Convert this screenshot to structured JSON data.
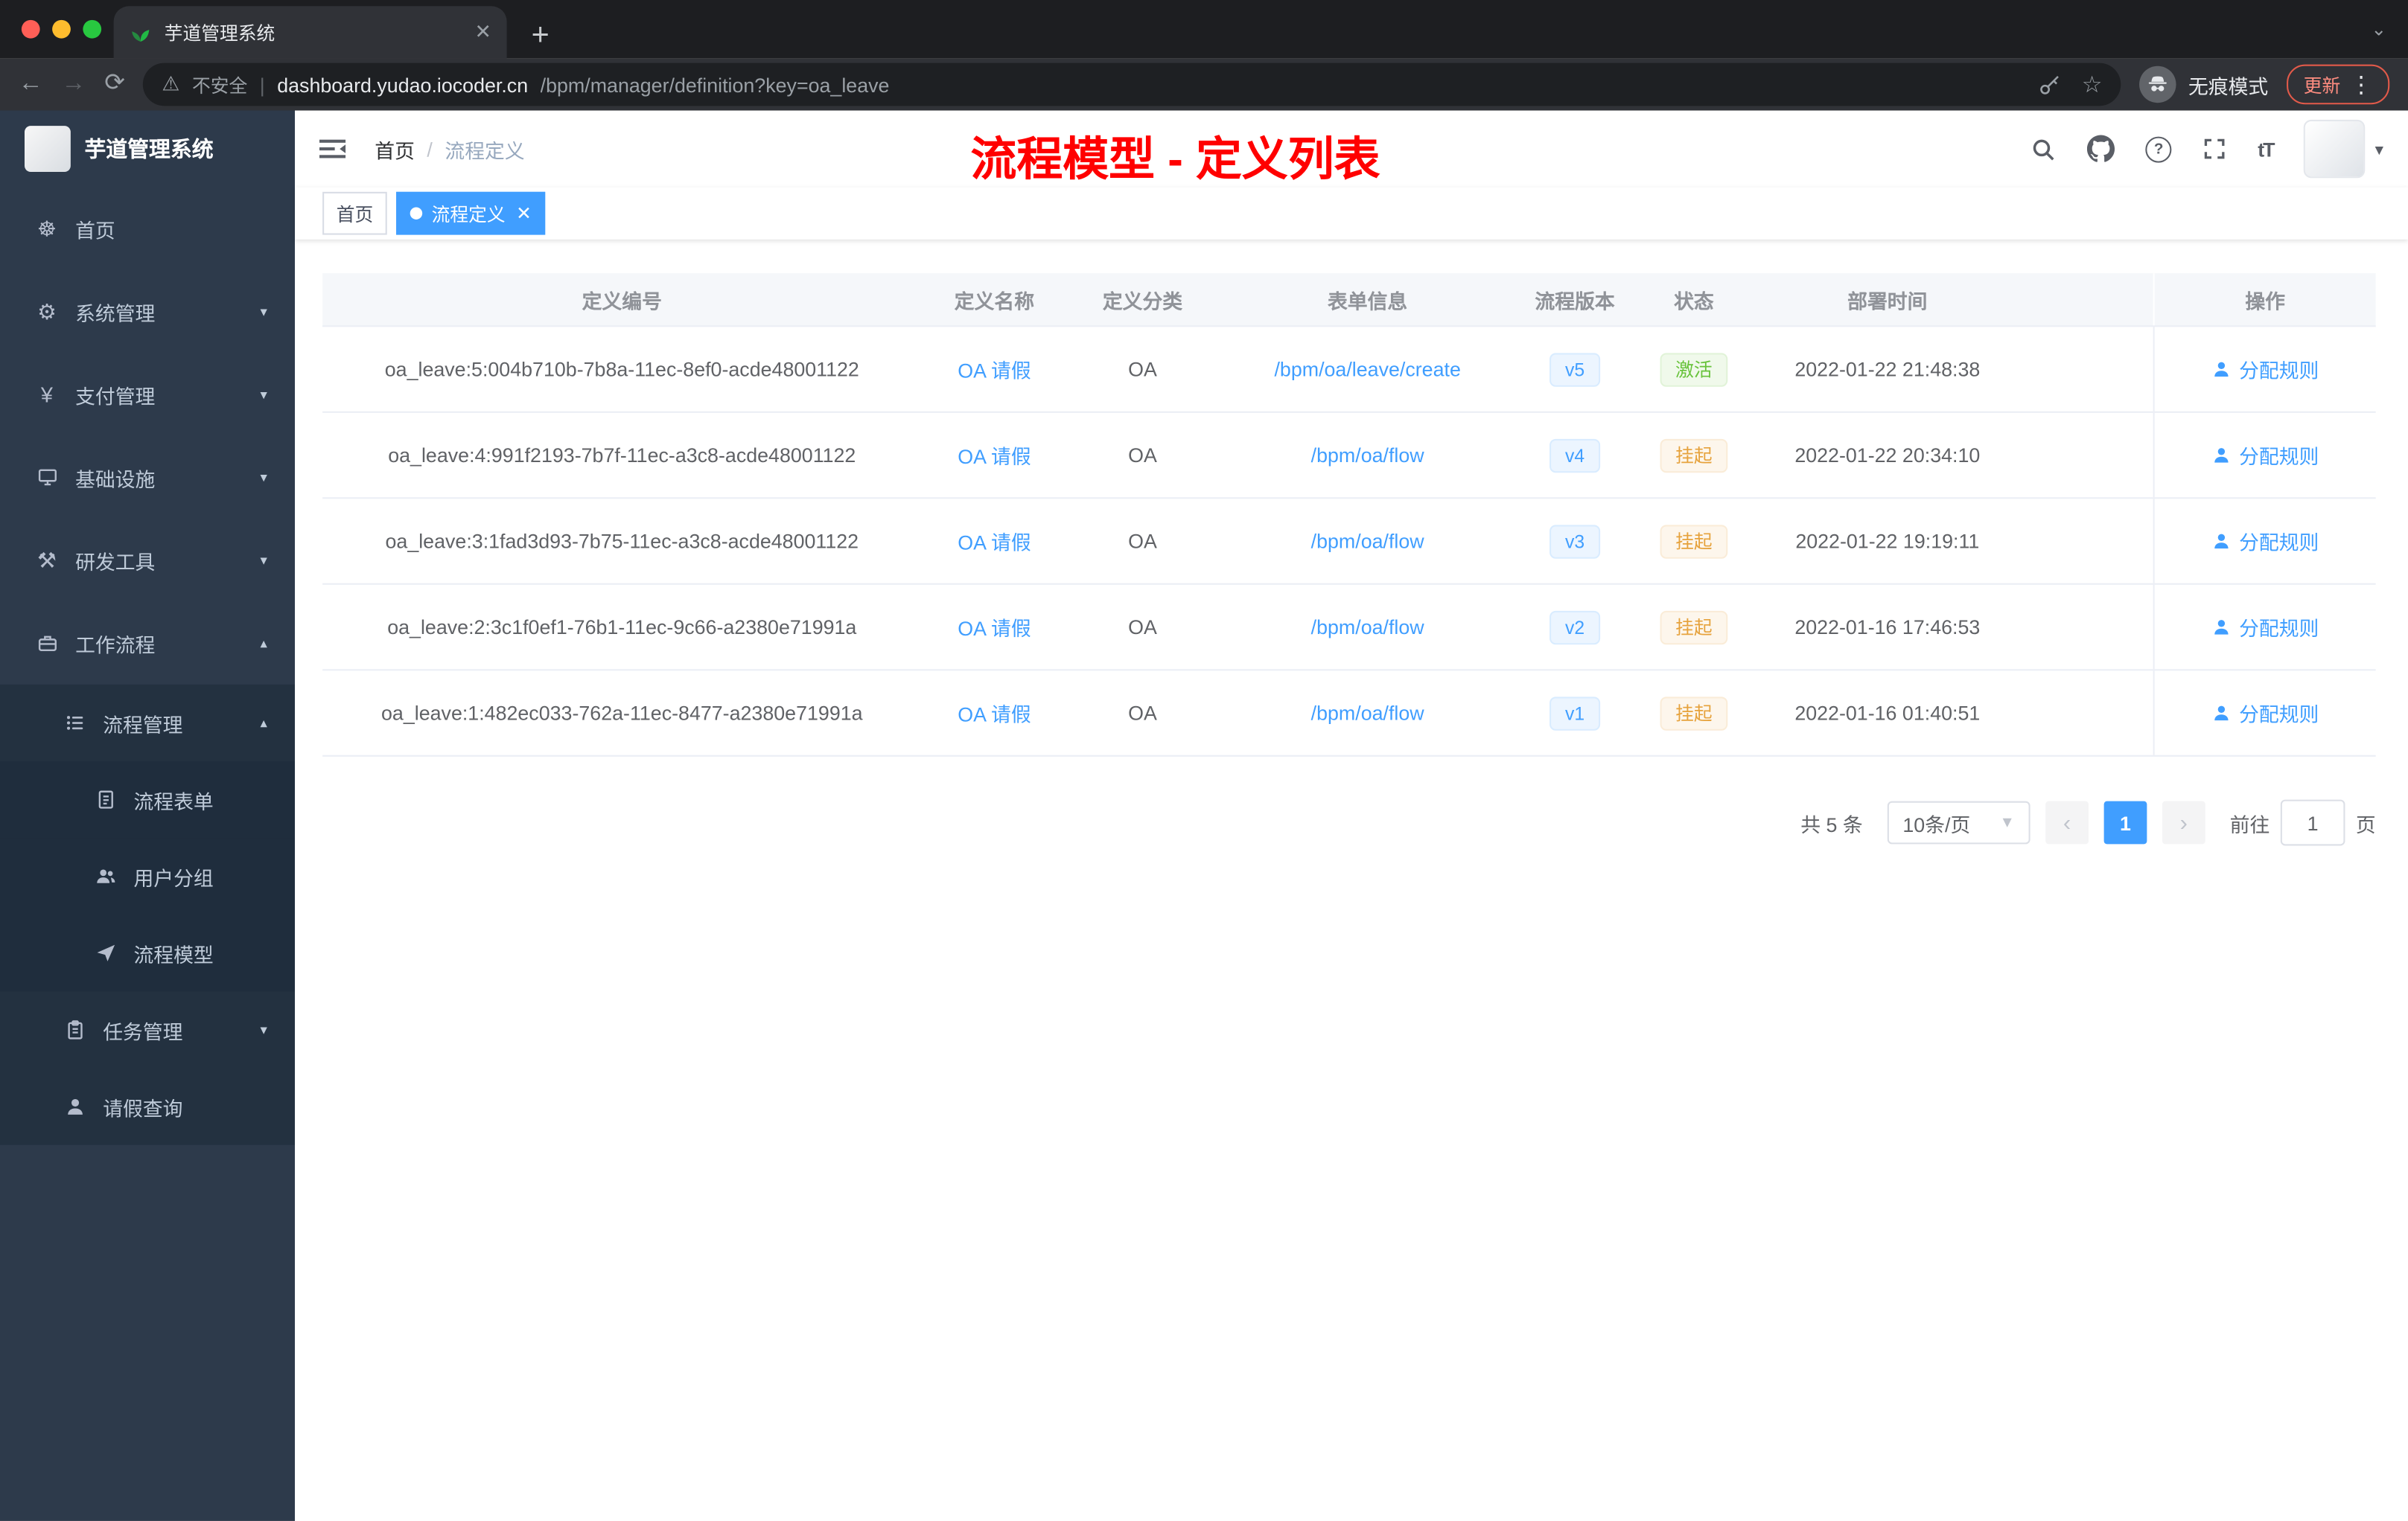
{
  "colors": {
    "accent": "#409eff",
    "success": "#67c23a",
    "warning": "#e6a23c",
    "annotation_red": "#ff0000",
    "sidebar_bg": "#2d3a4b",
    "submenu_bg": "#233140"
  },
  "browser": {
    "tab_title": "芋道管理系统",
    "security_label": "不安全",
    "url_host": "dashboard.yudao.iocoder.cn",
    "url_path": "/bpm/manager/definition?key=oa_leave",
    "incognito_label": "无痕模式",
    "update_label": "更新"
  },
  "sidebar": {
    "logo_title": "芋道管理系统",
    "items": [
      {
        "label": "首页",
        "icon": "home"
      },
      {
        "label": "系统管理",
        "icon": "settings"
      },
      {
        "label": "支付管理",
        "icon": "payment"
      },
      {
        "label": "基础设施",
        "icon": "infrastructure"
      },
      {
        "label": "研发工具",
        "icon": "dev-tools"
      },
      {
        "label": "工作流程",
        "icon": "workflow"
      },
      {
        "label": "流程管理",
        "icon": "process-management"
      },
      {
        "label": "流程表单",
        "icon": "process-form"
      },
      {
        "label": "用户分组",
        "icon": "user-group"
      },
      {
        "label": "流程模型",
        "icon": "process-model"
      },
      {
        "label": "任务管理",
        "icon": "task-management"
      },
      {
        "label": "请假查询",
        "icon": "leave-query"
      }
    ]
  },
  "header": {
    "breadcrumb_home": "首页",
    "breadcrumb_separator": "/",
    "breadcrumb_current": "流程定义",
    "annotation": "流程模型 - 定义列表",
    "icons": {
      "text_size": "tT"
    }
  },
  "tags": [
    {
      "label": "首页",
      "active": false
    },
    {
      "label": "流程定义",
      "active": true
    }
  ],
  "table": {
    "columns": [
      "定义编号",
      "定义名称",
      "定义分类",
      "表单信息",
      "流程版本",
      "状态",
      "部署时间",
      "操作"
    ],
    "rows": [
      {
        "id": "oa_leave:5:004b710b-7b8a-11ec-8ef0-acde48001122",
        "name": "OA 请假",
        "category": "OA",
        "form": "/bpm/oa/leave/create",
        "version": "v5",
        "status": "激活",
        "status_type": "success",
        "time": "2022-01-22 21:48:38",
        "action": "分配规则"
      },
      {
        "id": "oa_leave:4:991f2193-7b7f-11ec-a3c8-acde48001122",
        "name": "OA 请假",
        "category": "OA",
        "form": "/bpm/oa/flow",
        "version": "v4",
        "status": "挂起",
        "status_type": "warning",
        "time": "2022-01-22 20:34:10",
        "action": "分配规则"
      },
      {
        "id": "oa_leave:3:1fad3d93-7b75-11ec-a3c8-acde48001122",
        "name": "OA 请假",
        "category": "OA",
        "form": "/bpm/oa/flow",
        "version": "v3",
        "status": "挂起",
        "status_type": "warning",
        "time": "2022-01-22 19:19:11",
        "action": "分配规则"
      },
      {
        "id": "oa_leave:2:3c1f0ef1-76b1-11ec-9c66-a2380e71991a",
        "name": "OA 请假",
        "category": "OA",
        "form": "/bpm/oa/flow",
        "version": "v2",
        "status": "挂起",
        "status_type": "warning",
        "time": "2022-01-16 17:46:53",
        "action": "分配规则"
      },
      {
        "id": "oa_leave:1:482ec033-762a-11ec-8477-a2380e71991a",
        "name": "OA 请假",
        "category": "OA",
        "form": "/bpm/oa/flow",
        "version": "v1",
        "status": "挂起",
        "status_type": "warning",
        "time": "2022-01-16 01:40:51",
        "action": "分配规则"
      }
    ]
  },
  "pagination": {
    "total_label": "共 5 条",
    "size_label": "10条/页",
    "current_page": "1",
    "goto_label": "前往",
    "goto_value": "1",
    "page_unit": "页"
  }
}
